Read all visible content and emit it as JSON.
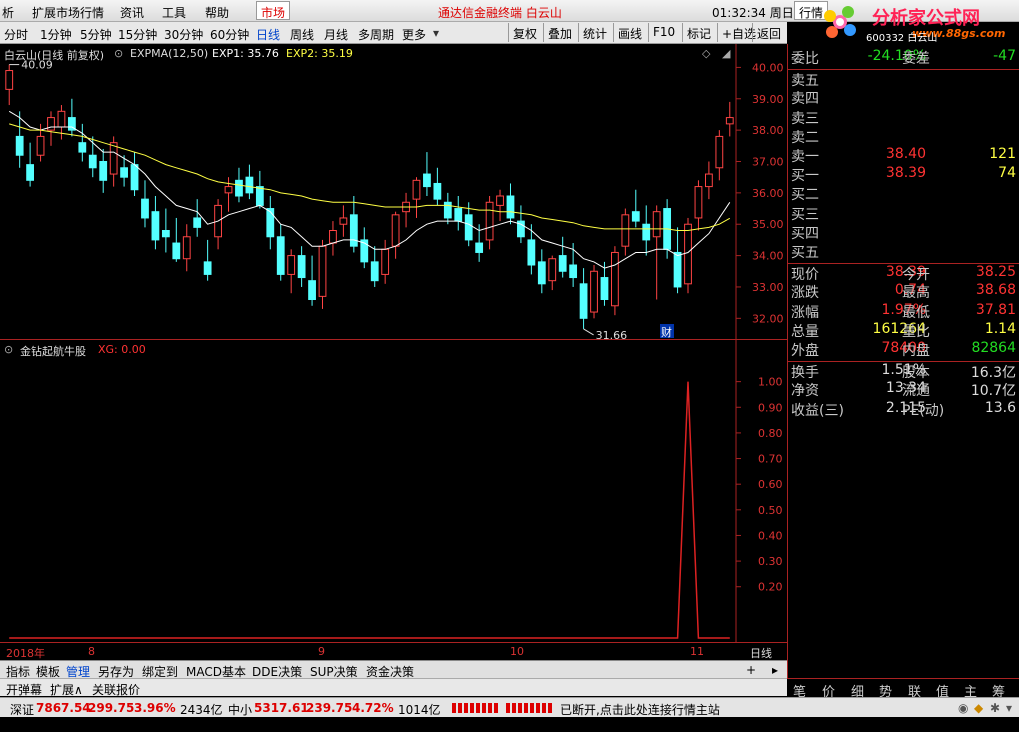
{
  "menubar": {
    "items": [
      "析",
      "扩展市场行情",
      "资讯",
      "工具",
      "帮助",
      "市场"
    ],
    "title": "通达信金融终端  白云山",
    "time": "01:32:34 周日",
    "quote_tab": "行情"
  },
  "logo": {
    "main": "分析家公式网",
    "url": "www.88gs.com",
    "code": "600332 白云山"
  },
  "toolbar": {
    "periods": [
      "分时",
      "1分钟",
      "5分钟",
      "15分钟",
      "30分钟",
      "60分钟",
      "日线",
      "周线",
      "月线",
      "多周期",
      "更多"
    ],
    "active_period": "日线",
    "buttons": [
      "复权",
      "叠加",
      "统计",
      "画线",
      "F10",
      "标记",
      "+自选",
      "返回"
    ]
  },
  "kline": {
    "header": "白云山(日线 前复权)",
    "indicator": "EXPMA(12,50)",
    "exp1_label": "EXP1: 35.76",
    "exp2_label": "EXP2: 35.19",
    "high_marker": "40.09",
    "low_marker": "31.66",
    "fin_marker": "财",
    "y_ticks": [
      "40.00",
      "39.00",
      "38.00",
      "37.00",
      "36.00",
      "35.00",
      "34.00",
      "33.00",
      "32.00"
    ]
  },
  "xg": {
    "header": "金钻起航牛股",
    "value": "XG: 0.00",
    "y_ticks": [
      "1.00",
      "0.90",
      "0.80",
      "0.70",
      "0.60",
      "0.50",
      "0.40",
      "0.30",
      "0.20"
    ]
  },
  "xaxis": {
    "labels": [
      "2018年",
      "8",
      "9",
      "10",
      "11"
    ],
    "period": "日线"
  },
  "chart_data": {
    "type": "candlestick",
    "y_range": [
      31.5,
      40.3
    ],
    "candles": [
      [
        39.3,
        40.09,
        38.8,
        39.9
      ],
      [
        37.8,
        38.6,
        36.8,
        37.2
      ],
      [
        36.9,
        37.6,
        36.2,
        36.4
      ],
      [
        37.2,
        38.2,
        37.0,
        37.8
      ],
      [
        38.0,
        38.6,
        37.5,
        38.4
      ],
      [
        38.1,
        38.8,
        37.7,
        38.6
      ],
      [
        38.4,
        39.0,
        37.8,
        38.0
      ],
      [
        37.6,
        38.2,
        37.0,
        37.3
      ],
      [
        37.2,
        37.8,
        36.5,
        36.8
      ],
      [
        37.0,
        37.4,
        36.0,
        36.4
      ],
      [
        36.6,
        37.8,
        36.2,
        37.6
      ],
      [
        36.8,
        37.2,
        36.2,
        36.5
      ],
      [
        36.9,
        37.3,
        35.9,
        36.1
      ],
      [
        35.8,
        36.4,
        34.9,
        35.2
      ],
      [
        35.4,
        35.9,
        34.2,
        34.5
      ],
      [
        34.8,
        35.5,
        34.1,
        34.6
      ],
      [
        34.4,
        35.2,
        33.8,
        33.9
      ],
      [
        33.9,
        35.0,
        33.5,
        34.6
      ],
      [
        35.2,
        35.8,
        34.6,
        34.9
      ],
      [
        33.8,
        34.5,
        33.2,
        33.4
      ],
      [
        34.6,
        35.8,
        34.2,
        35.6
      ],
      [
        36.0,
        36.5,
        35.4,
        36.2
      ],
      [
        36.4,
        36.8,
        35.7,
        35.9
      ],
      [
        36.5,
        36.9,
        35.8,
        36.0
      ],
      [
        36.2,
        36.7,
        35.5,
        35.6
      ],
      [
        35.5,
        35.9,
        34.2,
        34.6
      ],
      [
        34.6,
        35.0,
        33.2,
        33.4
      ],
      [
        33.4,
        34.2,
        32.8,
        34.0
      ],
      [
        34.0,
        34.3,
        33.0,
        33.3
      ],
      [
        33.2,
        34.0,
        32.4,
        32.6
      ],
      [
        32.7,
        34.5,
        32.3,
        34.3
      ],
      [
        34.4,
        35.1,
        34.0,
        34.8
      ],
      [
        35.0,
        35.6,
        34.6,
        35.2
      ],
      [
        35.3,
        35.9,
        34.1,
        34.3
      ],
      [
        34.5,
        34.9,
        33.6,
        33.8
      ],
      [
        33.8,
        34.3,
        33.0,
        33.2
      ],
      [
        33.4,
        34.5,
        33.1,
        34.2
      ],
      [
        34.3,
        35.4,
        33.9,
        35.3
      ],
      [
        35.4,
        36.0,
        34.9,
        35.7
      ],
      [
        35.8,
        36.5,
        35.2,
        36.4
      ],
      [
        36.6,
        37.3,
        35.9,
        36.2
      ],
      [
        36.3,
        36.8,
        35.6,
        35.8
      ],
      [
        35.7,
        36.0,
        35.0,
        35.2
      ],
      [
        35.5,
        35.9,
        34.8,
        35.1
      ],
      [
        35.3,
        35.7,
        34.3,
        34.5
      ],
      [
        34.4,
        35.0,
        33.8,
        34.1
      ],
      [
        34.5,
        35.9,
        34.2,
        35.7
      ],
      [
        35.6,
        36.1,
        35.1,
        35.9
      ],
      [
        35.9,
        36.3,
        35.0,
        35.2
      ],
      [
        35.1,
        35.6,
        34.4,
        34.6
      ],
      [
        34.5,
        35.0,
        33.4,
        33.7
      ],
      [
        33.8,
        34.2,
        32.8,
        33.1
      ],
      [
        33.2,
        34.0,
        32.9,
        33.9
      ],
      [
        34.0,
        34.6,
        33.3,
        33.5
      ],
      [
        33.7,
        34.4,
        33.0,
        33.3
      ],
      [
        33.1,
        33.6,
        31.66,
        32.0
      ],
      [
        32.2,
        33.7,
        32.0,
        33.5
      ],
      [
        33.3,
        33.8,
        32.4,
        32.6
      ],
      [
        32.4,
        34.3,
        32.1,
        34.1
      ],
      [
        34.3,
        35.5,
        34.0,
        35.3
      ],
      [
        35.4,
        36.1,
        34.9,
        35.1
      ],
      [
        35.0,
        35.6,
        34.0,
        34.5
      ],
      [
        34.6,
        35.6,
        32.6,
        35.4
      ],
      [
        35.5,
        35.8,
        33.9,
        34.2
      ],
      [
        34.1,
        34.9,
        32.8,
        33.0
      ],
      [
        33.1,
        35.2,
        32.8,
        35.0
      ],
      [
        35.2,
        36.4,
        34.8,
        36.2
      ],
      [
        36.2,
        37.0,
        35.8,
        36.6
      ],
      [
        36.8,
        38.0,
        36.4,
        37.8
      ],
      [
        38.2,
        38.9,
        37.8,
        38.4
      ]
    ],
    "exp1": [
      38.6,
      38.4,
      38.1,
      38.0,
      38.1,
      38.1,
      38.1,
      37.9,
      37.6,
      37.3,
      37.3,
      37.1,
      36.9,
      36.6,
      36.2,
      35.9,
      35.6,
      35.5,
      35.4,
      35.0,
      35.1,
      35.3,
      35.4,
      35.5,
      35.6,
      35.4,
      35.0,
      34.9,
      34.6,
      34.3,
      34.3,
      34.4,
      34.5,
      34.5,
      34.4,
      34.2,
      34.2,
      34.3,
      34.5,
      34.8,
      35.0,
      35.1,
      35.1,
      35.1,
      35.0,
      34.8,
      34.9,
      35.0,
      35.1,
      35.0,
      34.8,
      34.5,
      34.4,
      34.3,
      34.2,
      33.9,
      33.8,
      33.6,
      33.7,
      33.9,
      34.1,
      34.1,
      34.2,
      34.2,
      34.0,
      34.1,
      34.4,
      34.7,
      35.2,
      35.7
    ],
    "exp2": [
      38.2,
      38.1,
      38.0,
      38.0,
      37.95,
      37.9,
      37.85,
      37.8,
      37.7,
      37.6,
      37.5,
      37.4,
      37.3,
      37.2,
      37.05,
      36.9,
      36.8,
      36.7,
      36.6,
      36.45,
      36.35,
      36.3,
      36.25,
      36.2,
      36.15,
      36.1,
      36.0,
      35.95,
      35.9,
      35.8,
      35.75,
      35.7,
      35.7,
      35.7,
      35.65,
      35.6,
      35.55,
      35.55,
      35.55,
      35.55,
      35.6,
      35.6,
      35.6,
      35.55,
      35.5,
      35.45,
      35.45,
      35.4,
      35.4,
      35.35,
      35.3,
      35.2,
      35.15,
      35.1,
      35.05,
      34.95,
      34.9,
      34.85,
      34.85,
      34.85,
      34.85,
      34.85,
      34.85,
      34.85,
      34.8,
      34.8,
      34.85,
      34.9,
      35.0,
      35.19
    ],
    "xg_values": [
      0,
      0,
      0,
      0,
      0,
      0,
      0,
      0,
      0,
      0,
      0,
      0,
      0,
      0,
      0,
      0,
      0,
      0,
      0,
      0,
      0,
      0,
      0,
      0,
      0,
      0,
      0,
      0,
      0,
      0,
      0,
      0,
      0,
      0,
      0,
      0,
      0,
      0,
      0,
      0,
      0,
      0,
      0,
      0,
      0,
      0,
      0,
      0,
      0,
      0,
      0,
      0,
      0,
      0,
      0,
      0,
      0,
      0,
      0,
      0,
      0,
      0,
      0,
      0,
      0,
      1,
      0,
      0,
      0,
      0
    ],
    "xg_y_range": [
      0,
      1.1
    ]
  },
  "quote": {
    "rows": [
      {
        "k": "委比",
        "v": "-24.10%",
        "k2": "委差",
        "v2": "-47"
      },
      {
        "k": "卖五",
        "v": "",
        "k2": "",
        "v2": ""
      },
      {
        "k": "卖四",
        "v": "",
        "k2": "",
        "v2": ""
      },
      {
        "k": "卖三",
        "v": "",
        "k2": "",
        "v2": ""
      },
      {
        "k": "卖二",
        "v": "",
        "k2": "",
        "v2": ""
      },
      {
        "k": "卖一",
        "v": "38.40",
        "k2": "",
        "v2": "121"
      },
      {
        "k": "买一",
        "v": "38.39",
        "k2": "",
        "v2": "74"
      },
      {
        "k": "买二",
        "v": "",
        "k2": "",
        "v2": ""
      },
      {
        "k": "买三",
        "v": "",
        "k2": "",
        "v2": ""
      },
      {
        "k": "买四",
        "v": "",
        "k2": "",
        "v2": ""
      },
      {
        "k": "买五",
        "v": "",
        "k2": "",
        "v2": ""
      },
      {
        "k": "现价",
        "v": "38.39",
        "k2": "今开",
        "v2": "38.25"
      },
      {
        "k": "涨跌",
        "v": "0.74",
        "k2": "最高",
        "v2": "38.68"
      },
      {
        "k": "涨幅",
        "v": "1.97%",
        "k2": "最低",
        "v2": "37.81"
      },
      {
        "k": "总量",
        "v": "161264",
        "k2": "量比",
        "v2": "1.14"
      },
      {
        "k": "外盘",
        "v": "78400",
        "k2": "内盘",
        "v2": "82864"
      },
      {
        "k": "换手",
        "v": "1.51%",
        "k2": "股本",
        "v2": "16.3亿"
      },
      {
        "k": "净资",
        "v": "13.34",
        "k2": "流通",
        "v2": "10.7亿"
      },
      {
        "k": "收益(三)",
        "v": "2.115",
        "k2": "PE(动)",
        "v2": "13.6"
      }
    ],
    "tabs": [
      "笔",
      "价",
      "细",
      "势",
      "联",
      "值",
      "主",
      "筹"
    ]
  },
  "bottom_tabs": [
    "指标",
    "模板",
    "管理",
    "另存为",
    "绑定到",
    "MACD基本",
    "DDE决策",
    "SUP决策",
    "资金决策"
  ],
  "bottom_row2": [
    "开弹幕",
    "扩展∧",
    "关联报价"
  ],
  "status": {
    "sz_label": "深证",
    "sz_val": "7867.54",
    "sz_chg": "299.75",
    "sz_pct": "3.96%",
    "sz_amt": "2434亿",
    "zx_label": "中小",
    "zx_val": "5317.61",
    "zx_chg": "239.75",
    "zx_pct": "4.72%",
    "zx_amt": "1014亿",
    "conn": "已断开,点击此处连接行情主站"
  }
}
